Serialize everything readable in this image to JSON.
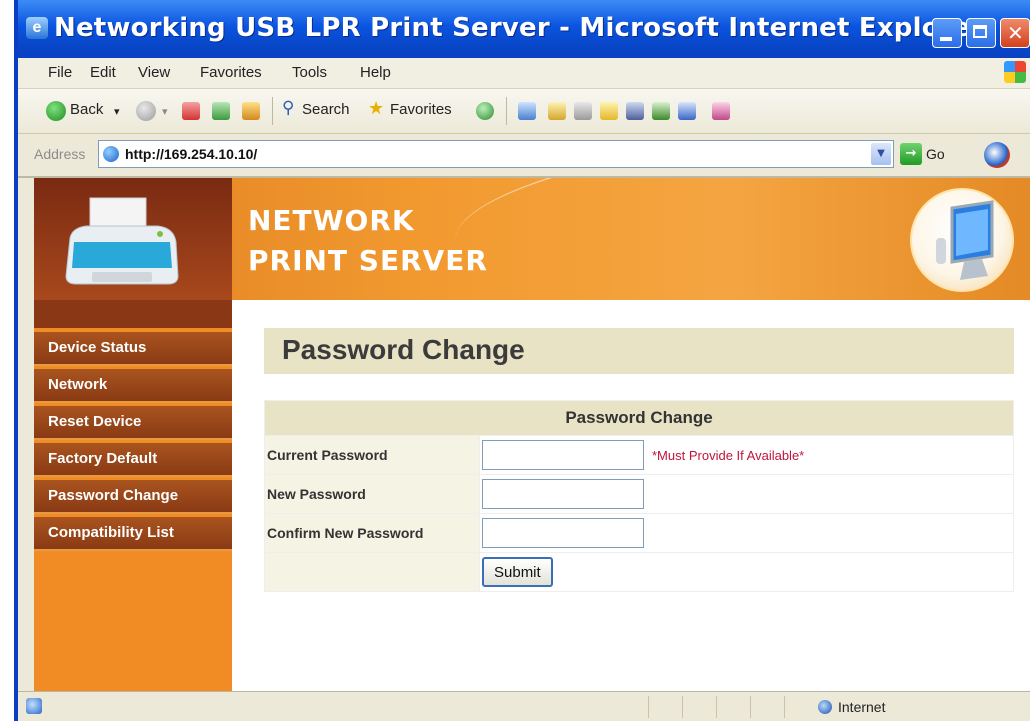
{
  "window": {
    "title": "Networking USB LPR Print Server - Microsoft Internet Explorer"
  },
  "menu": [
    "File",
    "Edit",
    "View",
    "Favorites",
    "Tools",
    "Help"
  ],
  "toolbar": {
    "back_label": "Back",
    "search_label": "Search",
    "favorites_label": "Favorites"
  },
  "address": {
    "label": "Address",
    "url": "http://169.254.10.10/",
    "go_label": "Go"
  },
  "banner": {
    "line1": "NETWORK",
    "line2": "PRINT SERVER"
  },
  "sidebar": {
    "items": [
      "Device Status",
      "Network",
      "Reset Device",
      "Factory Default",
      "Password Change",
      "Compatibility List"
    ]
  },
  "page": {
    "title": "Password Change",
    "form": {
      "header": "Password Change",
      "current_label": "Current Password",
      "current_note": "*Must Provide If Available*",
      "new_label": "New Password",
      "confirm_label": "Confirm New Password",
      "submit_label": "Submit",
      "current_value": "",
      "new_value": "",
      "confirm_value": ""
    }
  },
  "statusbar": {
    "zone": "Internet"
  },
  "colors": {
    "titlebar": "#0a54e0",
    "banner_orange": "#f29a30",
    "nav_brown": "#8a3a14",
    "heading_beige": "#e9e3c6",
    "required_red": "#c0143c"
  },
  "icons": [
    "ie-icon",
    "back-icon",
    "forward-icon",
    "stop-icon",
    "refresh-icon",
    "home-icon",
    "search-icon",
    "favorites-icon",
    "media-icon",
    "mail-icon",
    "print-icon",
    "go-icon",
    "printer-icon",
    "monitor-icon",
    "internet-zone-icon"
  ]
}
